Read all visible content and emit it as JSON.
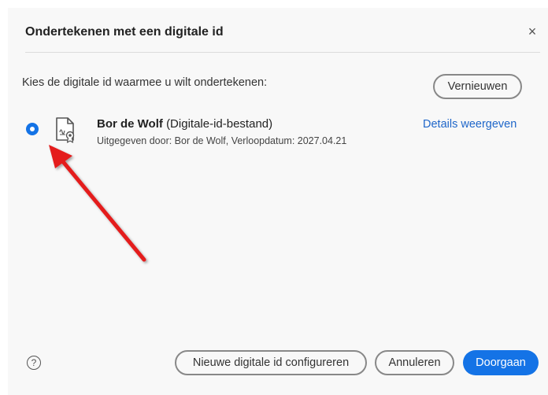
{
  "dialog": {
    "title": "Ondertekenen met een digitale id",
    "close_glyph": "×",
    "prompt": "Kies de digitale id waarmee u wilt ondertekenen:",
    "refresh_label": "Vernieuwen"
  },
  "identity": {
    "name": "Bor de Wolf",
    "type": "(Digitale-id-bestand)",
    "issued": "Uitgegeven door: Bor de Wolf, Verloopdatum: 2027.04.21",
    "details_label": "Details weergeven",
    "selected": true,
    "icon": "certificate-file-icon"
  },
  "footer": {
    "help_glyph": "?",
    "new_id_label": "Nieuwe digitale id configureren",
    "cancel_label": "Annuleren",
    "continue_label": "Doorgaan"
  },
  "colors": {
    "accent": "#1473e6",
    "link": "#1e66c9",
    "annotation_arrow": "#e41a1a"
  }
}
